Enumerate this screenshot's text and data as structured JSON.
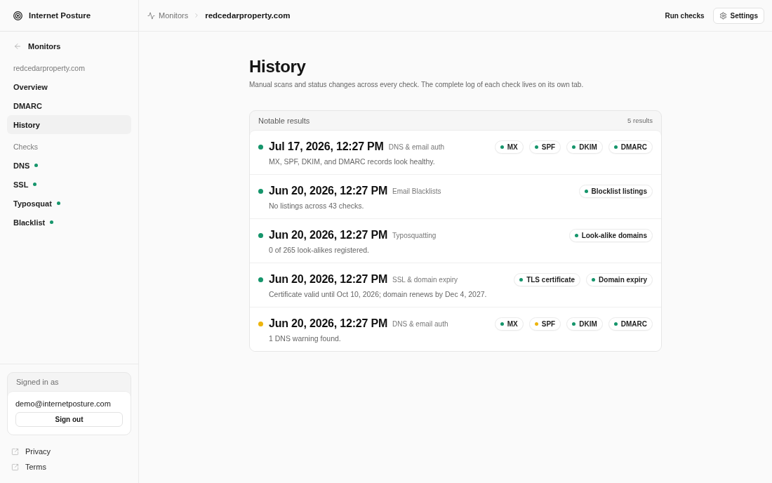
{
  "brand": {
    "name": "Internet Posture"
  },
  "breadcrumb": {
    "parent": "Monitors",
    "current": "redcedarproperty.com"
  },
  "top_actions": {
    "run_checks": "Run checks",
    "settings": "Settings"
  },
  "sidebar": {
    "back_link": "Monitors",
    "domain": "redcedarproperty.com",
    "items": [
      {
        "label": "Overview",
        "selected": false
      },
      {
        "label": "DMARC",
        "selected": false
      },
      {
        "label": "History",
        "selected": true
      }
    ],
    "checks_heading": "Checks",
    "checks": [
      {
        "label": "DNS",
        "color": "#15956b"
      },
      {
        "label": "SSL",
        "color": "#15956b"
      },
      {
        "label": "Typosquat",
        "color": "#15956b"
      },
      {
        "label": "Blacklist",
        "color": "#15956b"
      }
    ]
  },
  "account": {
    "heading": "Signed in as",
    "email": "demo@internetposture.com",
    "sign_out": "Sign out"
  },
  "footer_links": [
    {
      "label": "Privacy"
    },
    {
      "label": "Terms"
    }
  ],
  "page": {
    "title": "History",
    "subtitle": "Manual scans and status changes across every check. The complete log of each check lives on its own tab."
  },
  "results": {
    "title": "Notable results",
    "count": "5 results",
    "rows": [
      {
        "color": "#15956b",
        "date": "Jul 17, 2026, 12:27 PM",
        "category": "DNS & email auth",
        "summary": "MX, SPF, DKIM, and DMARC records look healthy.",
        "tags": [
          {
            "label": "MX",
            "color": "#15956b"
          },
          {
            "label": "SPF",
            "color": "#15956b"
          },
          {
            "label": "DKIM",
            "color": "#15956b"
          },
          {
            "label": "DMARC",
            "color": "#15956b"
          }
        ]
      },
      {
        "color": "#15956b",
        "date": "Jun 20, 2026, 12:27 PM",
        "category": "Email Blacklists",
        "summary": "No listings across 43 checks.",
        "tags": [
          {
            "label": "Blocklist listings",
            "color": "#15956b"
          }
        ]
      },
      {
        "color": "#15956b",
        "date": "Jun 20, 2026, 12:27 PM",
        "category": "Typosquatting",
        "summary": "0 of 265 look-alikes registered.",
        "tags": [
          {
            "label": "Look-alike domains",
            "color": "#15956b"
          }
        ]
      },
      {
        "color": "#15956b",
        "date": "Jun 20, 2026, 12:27 PM",
        "category": "SSL & domain expiry",
        "summary": "Certificate valid until Oct 10, 2026; domain renews by Dec 4, 2027.",
        "tags": [
          {
            "label": "TLS certificate",
            "color": "#15956b"
          },
          {
            "label": "Domain expiry",
            "color": "#15956b"
          }
        ]
      },
      {
        "color": "#edb40c",
        "date": "Jun 20, 2026, 12:27 PM",
        "category": "DNS & email auth",
        "summary": "1 DNS warning found.",
        "tags": [
          {
            "label": "MX",
            "color": "#15956b"
          },
          {
            "label": "SPF",
            "color": "#edb40c"
          },
          {
            "label": "DKIM",
            "color": "#15956b"
          },
          {
            "label": "DMARC",
            "color": "#15956b"
          }
        ]
      }
    ]
  }
}
